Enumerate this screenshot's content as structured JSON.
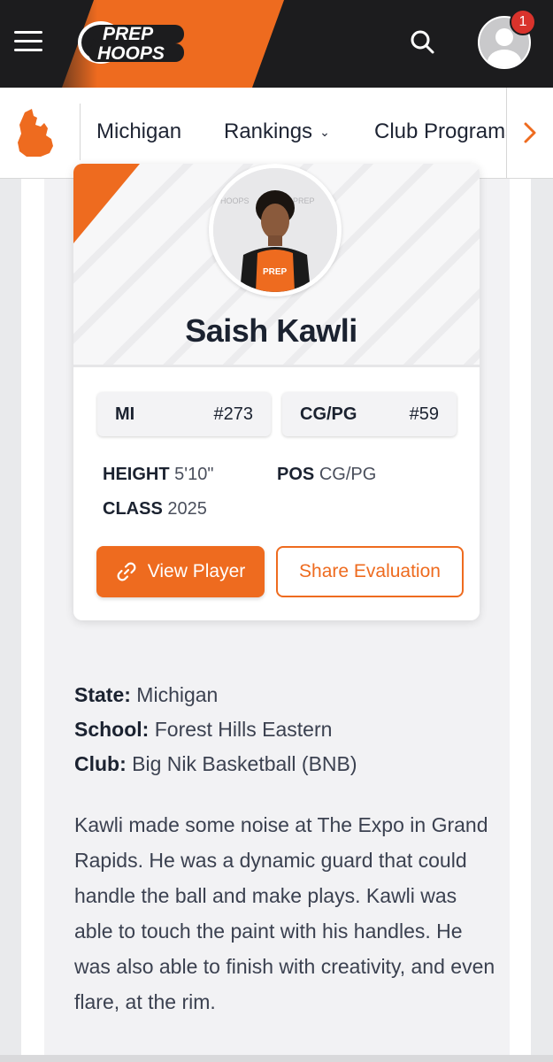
{
  "header": {
    "logo_line1": "PREP",
    "logo_line2": "HOOPS",
    "notification_count": "1"
  },
  "subnav": {
    "items": [
      {
        "label": "Michigan"
      },
      {
        "label": "Rankings"
      },
      {
        "label": "Club Programs"
      }
    ]
  },
  "player": {
    "name": "Saish Kawli",
    "state_rank": {
      "label": "MI",
      "value": "#273"
    },
    "position_rank": {
      "label": "CG/PG",
      "value": "#59"
    },
    "height_label": "HEIGHT",
    "height": "5'10\"",
    "pos_label": "POS",
    "pos": "CG/PG",
    "class_label": "CLASS",
    "class": "2025"
  },
  "actions": {
    "view_player": "View Player",
    "share_evaluation": "Share Evaluation"
  },
  "details": {
    "state_label": "State:",
    "state": "Michigan",
    "school_label": "School:",
    "school": "Forest Hills Eastern",
    "club_label": "Club:",
    "club": "Big Nik Basketball (BNB)"
  },
  "evaluation": "Kawli made some noise at The Expo in Grand Rapids. He was a dynamic guard that could handle the ball and make plays. Kawli was able to touch the paint with his handles. He was also able to finish with creativity, and even flare, at the rim.",
  "colors": {
    "brand_orange": "#ee6b1f",
    "header_dark": "#1c1c1e",
    "badge_red": "#d9332c"
  }
}
